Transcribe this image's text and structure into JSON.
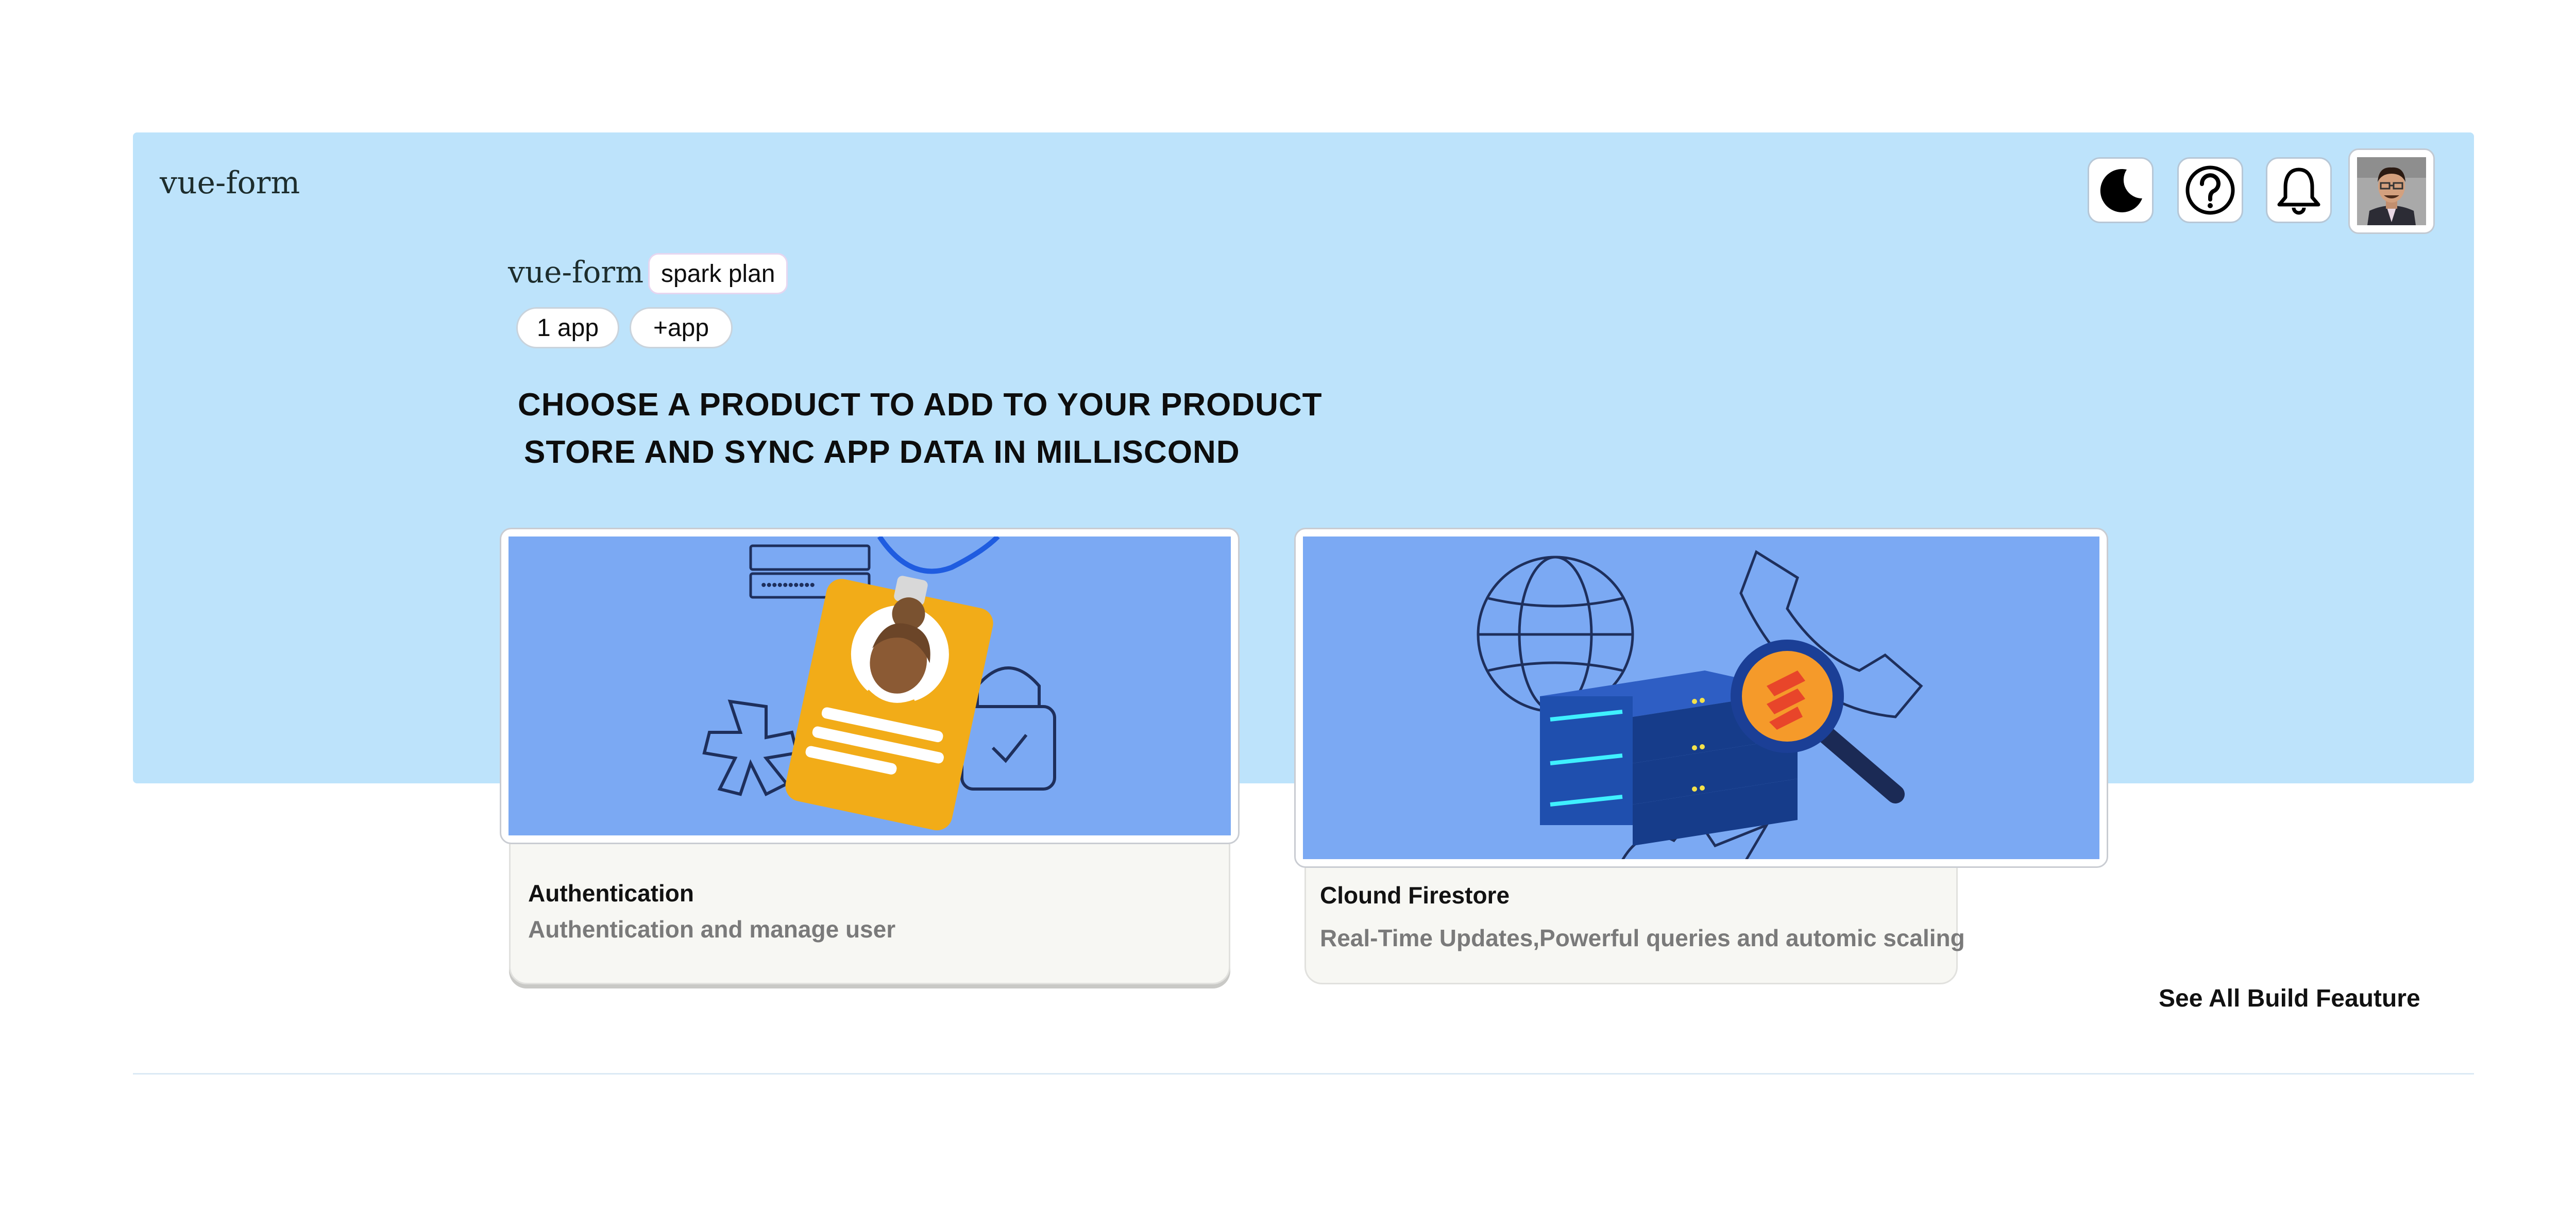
{
  "app": {
    "brand": "vue-form"
  },
  "header_icons": [
    {
      "name": "moon-icon"
    },
    {
      "name": "help-circle-icon"
    },
    {
      "name": "bell-icon"
    }
  ],
  "project": {
    "name": "vue-form",
    "plan": "spark plan",
    "pills": [
      "1 app",
      "+app"
    ]
  },
  "headline": {
    "line1": "CHOOSE A PRODUCT TO ADD TO YOUR PRODUCT",
    "line2": "STORE AND SYNC APP DATA IN MILLISCOND"
  },
  "cards": [
    {
      "title": "Authentication",
      "description": "Authentication and manage user"
    },
    {
      "title": "Clound Firestore",
      "description": "Real-Time Updates,Powerful queries and automic scaling"
    }
  ],
  "links": {
    "see_all": "See All Build Feauture"
  },
  "colors": {
    "hero_bg": "#bde3fb",
    "card_image_bg": "#7ba9f3",
    "card_body_bg": "#f7f7f3"
  }
}
